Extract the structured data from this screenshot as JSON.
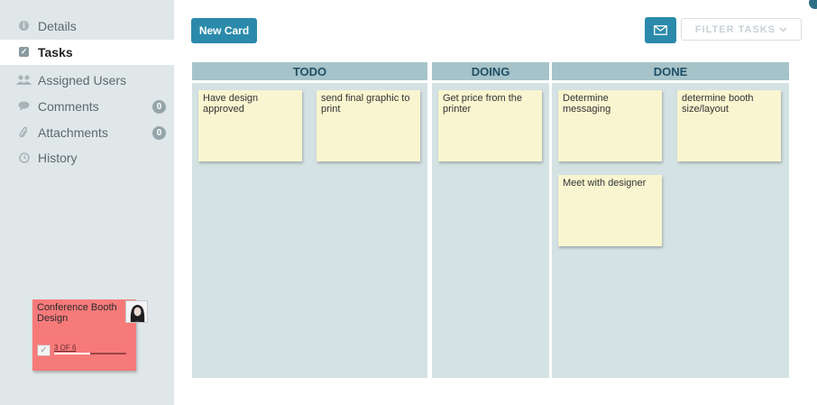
{
  "sidebar": {
    "items": [
      {
        "label": "Details",
        "icon": "info-icon"
      },
      {
        "label": "Tasks",
        "icon": "checkbox-icon"
      },
      {
        "label": "Assigned Users",
        "icon": "users-icon"
      },
      {
        "label": "Comments",
        "icon": "comment-icon",
        "count": "0"
      },
      {
        "label": "Attachments",
        "icon": "paperclip-icon",
        "count": "0"
      },
      {
        "label": "History",
        "icon": "clock-icon"
      }
    ],
    "active": "Tasks"
  },
  "project_card": {
    "title": "Conference Booth Design",
    "progress_text": "3 OF 6",
    "progress_fraction": 0.5,
    "color": "#f77a7a"
  },
  "toolbar": {
    "new_card_label": "New Card",
    "filter_label": "FILTER TASKS",
    "accent": "#2b8aab"
  },
  "board": {
    "columns": [
      {
        "title": "TODO",
        "cards": [
          "Have design approved",
          "send final graphic to print"
        ]
      },
      {
        "title": "DOING",
        "cards": [
          "Get price from the printer"
        ]
      },
      {
        "title": "DONE",
        "cards": [
          "Determine messaging",
          "determine booth size/layout",
          "Meet with designer"
        ]
      }
    ]
  }
}
